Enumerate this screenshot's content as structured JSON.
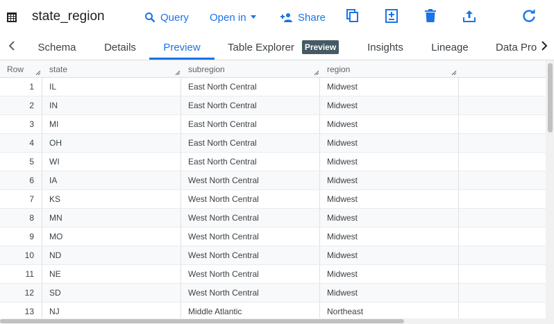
{
  "header": {
    "title": "state_region",
    "query_label": "Query",
    "open_in_label": "Open in",
    "share_label": "Share"
  },
  "tabs": [
    {
      "label": "Schema"
    },
    {
      "label": "Details"
    },
    {
      "label": "Preview"
    },
    {
      "label": "Table Explorer"
    },
    {
      "label": "Insights"
    },
    {
      "label": "Lineage"
    },
    {
      "label": "Data Pro"
    }
  ],
  "active_tab": "Preview",
  "table_explorer_badge": "Preview",
  "colors": {
    "accent": "#1a73e8",
    "badge_bg": "#455a64",
    "icon_gray": "#5f6368"
  },
  "grid": {
    "columns": [
      "Row",
      "state",
      "subregion",
      "region"
    ],
    "rows": [
      {
        "n": "1",
        "state": "IL",
        "subregion": "East North Central",
        "region": "Midwest"
      },
      {
        "n": "2",
        "state": "IN",
        "subregion": "East North Central",
        "region": "Midwest"
      },
      {
        "n": "3",
        "state": "MI",
        "subregion": "East North Central",
        "region": "Midwest"
      },
      {
        "n": "4",
        "state": "OH",
        "subregion": "East North Central",
        "region": "Midwest"
      },
      {
        "n": "5",
        "state": "WI",
        "subregion": "East North Central",
        "region": "Midwest"
      },
      {
        "n": "6",
        "state": "IA",
        "subregion": "West North Central",
        "region": "Midwest"
      },
      {
        "n": "7",
        "state": "KS",
        "subregion": "West North Central",
        "region": "Midwest"
      },
      {
        "n": "8",
        "state": "MN",
        "subregion": "West North Central",
        "region": "Midwest"
      },
      {
        "n": "9",
        "state": "MO",
        "subregion": "West North Central",
        "region": "Midwest"
      },
      {
        "n": "10",
        "state": "ND",
        "subregion": "West North Central",
        "region": "Midwest"
      },
      {
        "n": "11",
        "state": "NE",
        "subregion": "West North Central",
        "region": "Midwest"
      },
      {
        "n": "12",
        "state": "SD",
        "subregion": "West North Central",
        "region": "Midwest"
      },
      {
        "n": "13",
        "state": "NJ",
        "subregion": "Middle Atlantic",
        "region": "Northeast"
      }
    ]
  }
}
